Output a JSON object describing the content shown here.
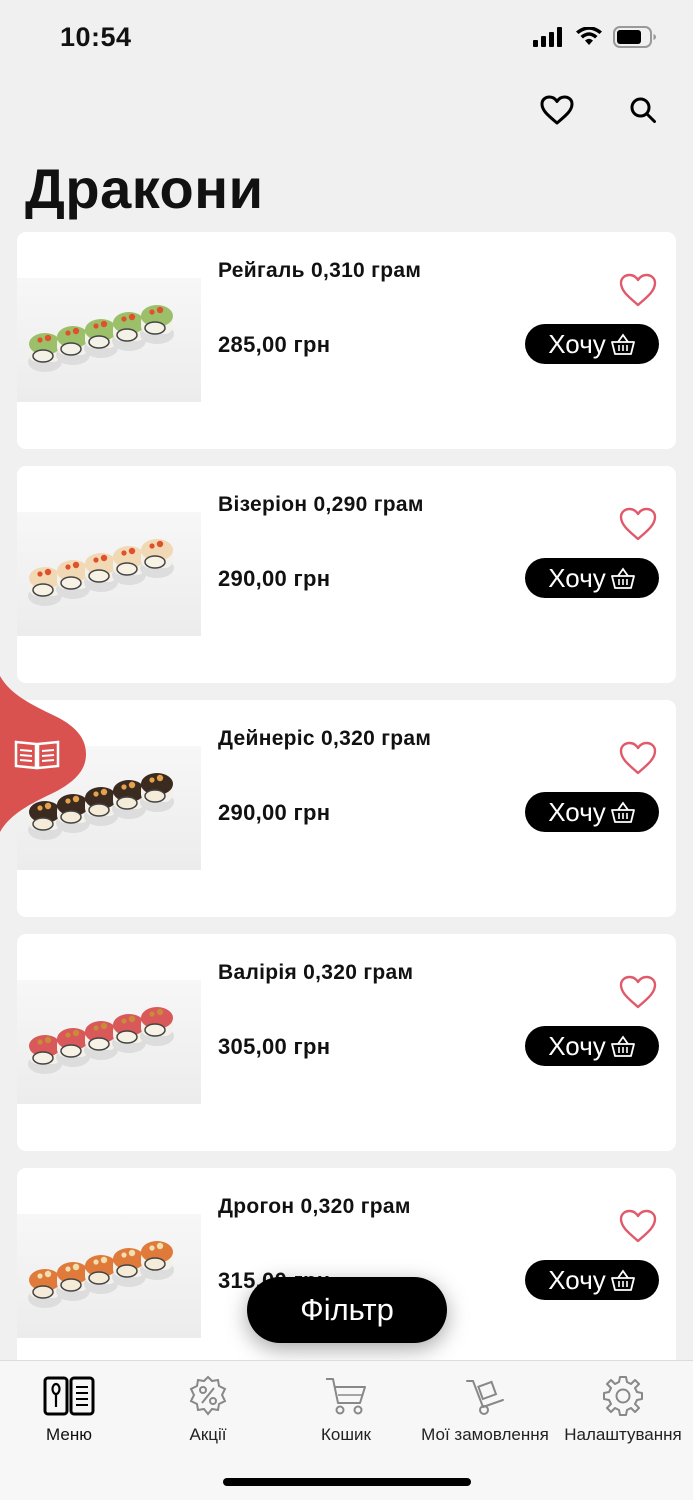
{
  "status_bar": {
    "time": "10:54"
  },
  "header": {
    "favorites_icon": "heart-outline-icon",
    "search_icon": "search-icon"
  },
  "page_title": "Дракони",
  "products": [
    {
      "name": "Рейгаль 0,310 грам",
      "price": "285,00 грн",
      "button_label": "Хочу",
      "roll_top": "#9cc06a",
      "roll_fill": "#f4f1e6",
      "topping": "#e0502a"
    },
    {
      "name": "Візеріон 0,290 грам",
      "price": "290,00 грн",
      "button_label": "Хочу",
      "roll_top": "#f2d9b5",
      "roll_fill": "#f7f2e4",
      "topping": "#e0502a"
    },
    {
      "name": "Дейнеріс 0,320 грам",
      "price": "290,00 грн",
      "button_label": "Хочу",
      "roll_top": "#3a2a20",
      "roll_fill": "#f4ecd8",
      "topping": "#e6a24a"
    },
    {
      "name": "Валірія 0,320 грам",
      "price": "305,00 грн",
      "button_label": "Хочу",
      "roll_top": "#d9585a",
      "roll_fill": "#f7f2e6",
      "topping": "#c98a3a"
    },
    {
      "name": "Дрогон 0,320 грам",
      "price": "315,00 грн",
      "button_label": "Хочу",
      "roll_top": "#e07a3a",
      "roll_fill": "#f4ecd8",
      "topping": "#f0e0b0"
    }
  ],
  "filter_button": "Фільтр",
  "side_tab": {
    "icon": "open-book-icon",
    "color": "#d9524f"
  },
  "bottom_nav": [
    {
      "label": "Меню",
      "icon": "menu-book-icon",
      "active": true
    },
    {
      "label": "Акції",
      "icon": "percent-badge-icon",
      "active": false
    },
    {
      "label": "Кошик",
      "icon": "cart-icon",
      "active": false
    },
    {
      "label": "Мої замовлення",
      "icon": "hand-truck-icon",
      "active": false
    },
    {
      "label": "Налаштування",
      "icon": "gear-icon",
      "active": false
    }
  ],
  "colors": {
    "accent": "#d9524f",
    "heart": "#e05a6a",
    "background": "#f0f0f0"
  }
}
